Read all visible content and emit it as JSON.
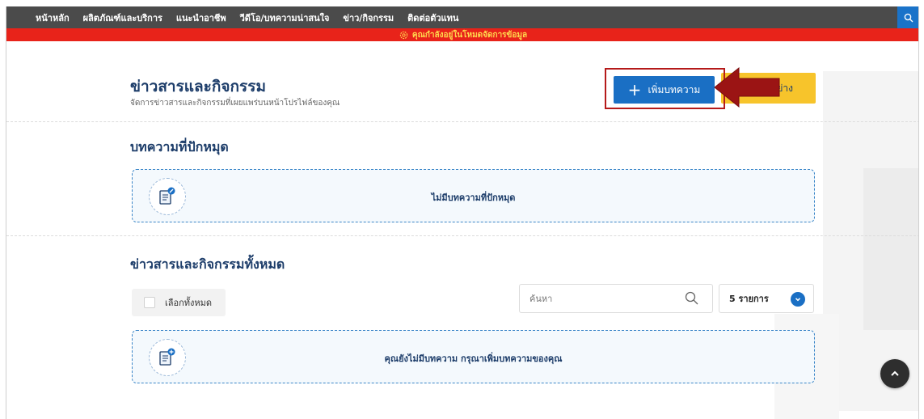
{
  "nav": {
    "items": [
      "หน้าหลัก",
      "ผลิตภัณฑ์และบริการ",
      "แนะนำอาชีพ",
      "วีดีโอ/บทความน่าสนใจ",
      "ข่าว/กิจกรรม",
      "ติดต่อตัวแทน"
    ]
  },
  "banner": {
    "text": "คุณกำลังอยู่ในโหมดจัดการข้อมูล"
  },
  "header": {
    "title": "ข่าวสารและกิจกรรม",
    "subtitle": "จัดการข่าวสารและกิจกรรมที่เผยแพร่บนหน้าโปรไฟล์ของคุณ",
    "add_button": "เพิ่มบทความ",
    "yellow_button_partial": "ย่าง"
  },
  "pinned": {
    "title": "บทความที่ปักหมุด",
    "empty_text": "ไม่มีบทความที่ปักหมุด"
  },
  "all_news": {
    "title": "ข่าวสารและกิจกรรมทั้งหมด",
    "select_all": "เลือกทั้งหมด",
    "search_placeholder": "ค้นหา",
    "per_page": "5 รายการ",
    "empty_text": "คุณยังไม่มีบทความ กรุณาเพิ่มบทความของคุณ"
  },
  "colors": {
    "nav_bg": "#4b4b4b",
    "banner_bg": "#e8231a",
    "primary": "#1a6fc4",
    "title": "#1d3d6a",
    "accent_yellow": "#f7c42b",
    "highlight_red": "#b51a1a"
  },
  "icons": [
    "search-icon",
    "gear-icon",
    "plus-icon",
    "pin-document-icon",
    "chevron-down-icon",
    "chevron-up-icon",
    "red-arrow"
  ]
}
